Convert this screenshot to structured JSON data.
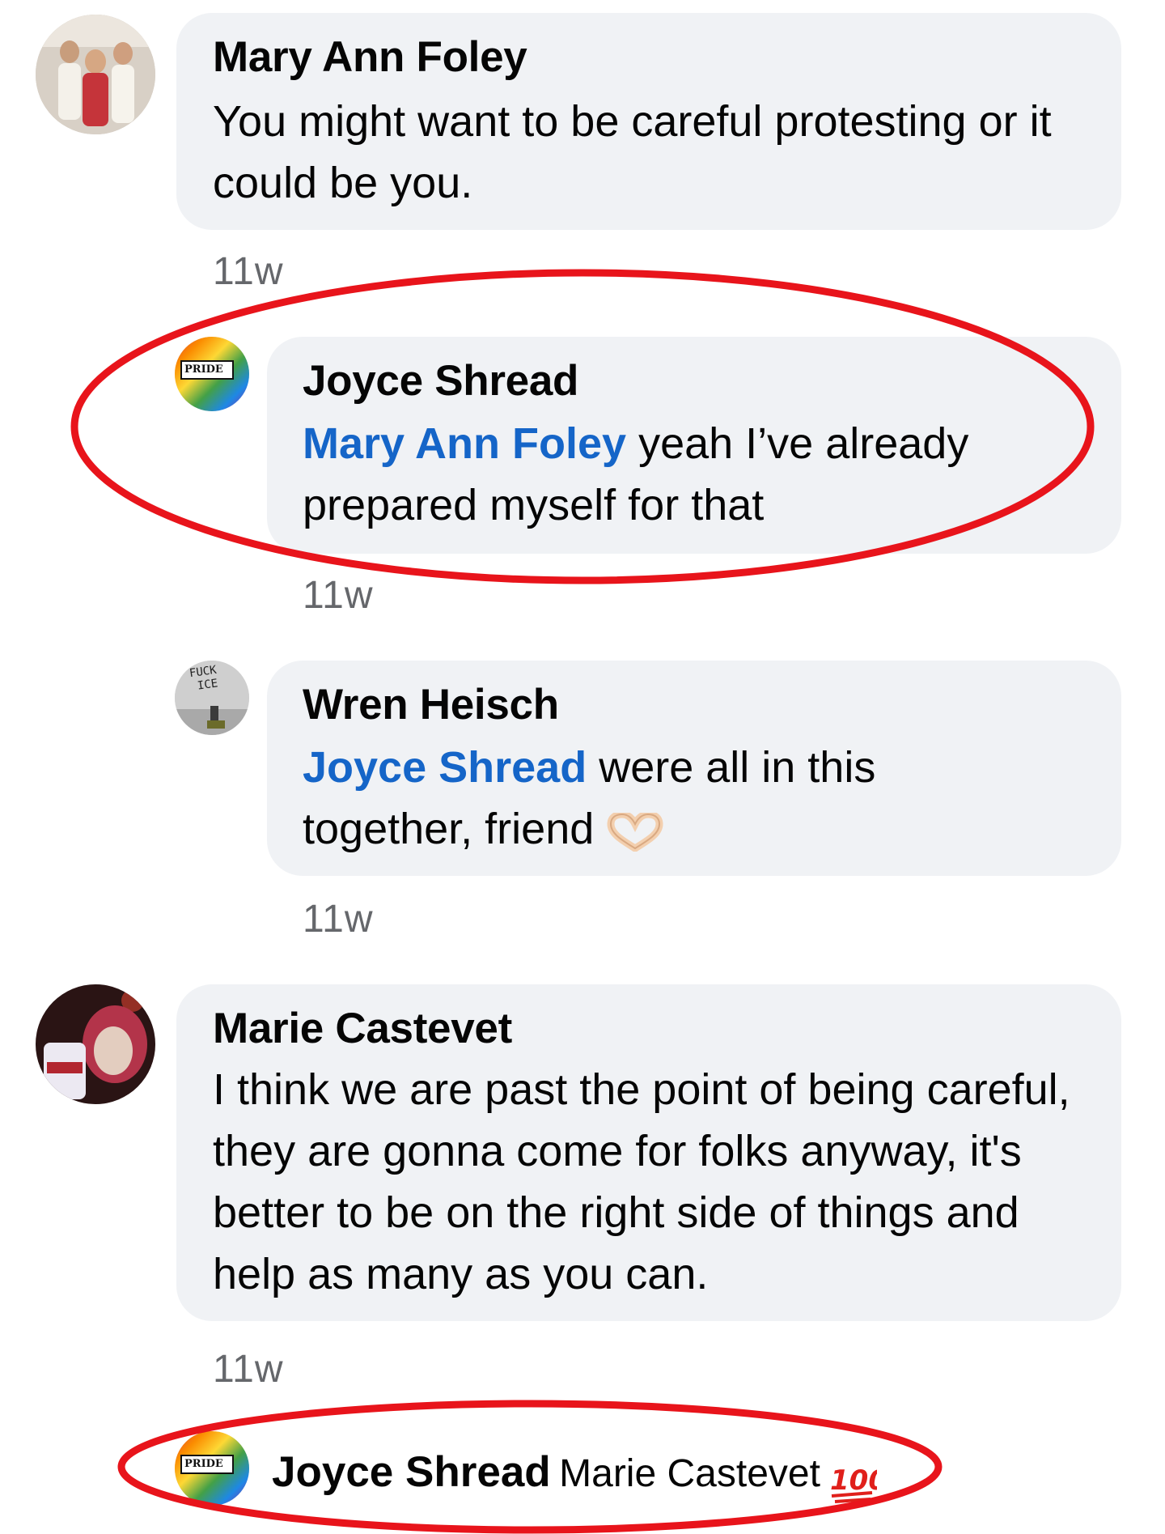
{
  "comments": [
    {
      "author": "Mary Ann Foley",
      "text": "You might want to be careful protesting or it could be you.",
      "time": "11w"
    },
    {
      "author": "Joyce Shread",
      "mention": "Mary Ann Foley",
      "text": " yeah I’ve already prepared myself for that",
      "time": "11w",
      "avatar_label": "PRIDE"
    },
    {
      "author": "Wren Heisch",
      "mention": "Joyce Shread",
      "text": " were all in this together, friend",
      "time": "11w",
      "avatar_label_1": "FUCK",
      "avatar_label_2": "ICE"
    },
    {
      "author": "Marie Castevet",
      "text": "I think we are past the point of being careful, they are gonna come for folks anyway, it's better to be on the right side of things and help as many as you can.",
      "time": "11w"
    },
    {
      "author": "Joyce Shread",
      "mention": "Marie Castevet",
      "avatar_label": "PRIDE",
      "emoji": "100"
    }
  ],
  "colors": {
    "bubble": "#f0f2f5",
    "mention": "#1565c8",
    "time": "#65676b",
    "highlight": "#e8141b"
  },
  "icons": [
    "heart-hands-icon",
    "hundred-points-icon"
  ]
}
